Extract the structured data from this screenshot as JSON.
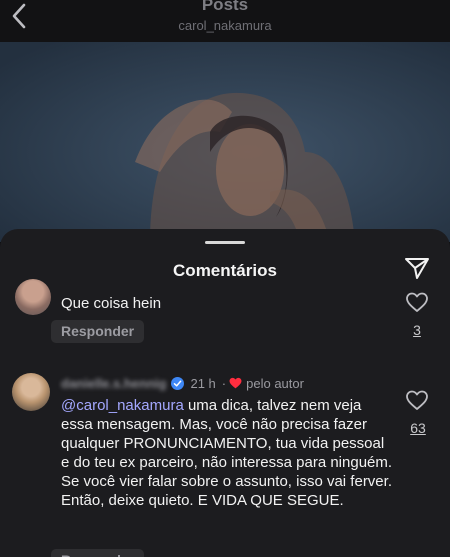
{
  "header": {
    "title": "Posts",
    "subtitle": "carol_nakamura",
    "back_icon": "chevron-left-icon"
  },
  "sheet": {
    "title": "Comentários",
    "share_icon": "paper-plane-icon"
  },
  "comments": [
    {
      "text": "Que coisa hein",
      "reply_label": "Responder",
      "likes": "3"
    },
    {
      "username": "danielle.s.hennig",
      "verified": true,
      "time": "21 h",
      "separator": "·",
      "liked_by_author_label": "pelo autor",
      "mention": "@carol_nakamura",
      "text": " uma dica, talvez nem veja essa mensagem. Mas, você não precisa fazer qualquer PRONUNCIAMENTO, tua vida pessoal e do teu ex parceiro, não interessa para ninguém. Se você vier falar sobre o assunto, isso vai ferver. Então, deixe quieto. E VIDA QUE SEGUE.",
      "reply_label": "Responder",
      "likes": "63"
    }
  ],
  "colors": {
    "background": "#0b0b0d",
    "sheet": "#1c1c1f",
    "mention": "#a4a8ff",
    "verified_badge": "#3e87f5",
    "author_heart": "#ff2d3f"
  }
}
